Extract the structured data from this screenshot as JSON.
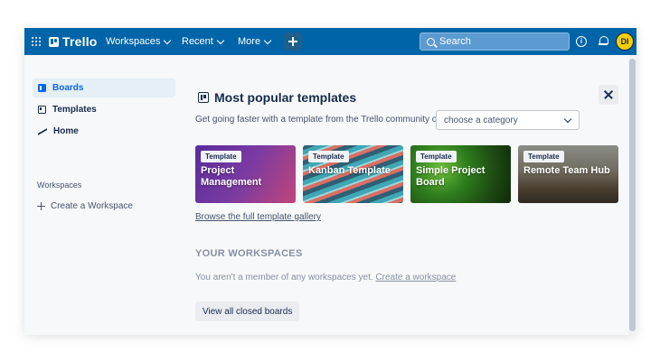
{
  "header": {
    "logo": "Trello",
    "nav": [
      {
        "label": "Workspaces"
      },
      {
        "label": "Recent"
      },
      {
        "label": "More"
      }
    ],
    "search_placeholder": "Search",
    "avatar_initials": "DI",
    "brand_color": "#0065a8"
  },
  "sidebar": {
    "items": [
      {
        "label": "Boards",
        "icon": "boards-icon",
        "active": true
      },
      {
        "label": "Templates",
        "icon": "templates-icon",
        "active": false
      },
      {
        "label": "Home",
        "icon": "home-icon",
        "active": false
      }
    ],
    "workspaces_heading": "Workspaces",
    "create_workspace": "Create a Workspace"
  },
  "main": {
    "title": "Most popular templates",
    "subtitle": "Get going faster with a template from the Trello community or",
    "category_select": "choose a category",
    "templates": [
      {
        "badge": "Template",
        "title": "Project Management"
      },
      {
        "badge": "Template",
        "title": "Kanban Template"
      },
      {
        "badge": "Template",
        "title": "Simple Project Board"
      },
      {
        "badge": "Template",
        "title": "Remote Team Hub"
      }
    ],
    "gallery_link": "Browse the full template gallery",
    "workspaces_heading": "YOUR WORKSPACES",
    "workspaces_empty": "You aren't a member of any workspaces yet.",
    "workspaces_create_link": "Create a workspace",
    "closed_boards_button": "View all closed boards"
  }
}
